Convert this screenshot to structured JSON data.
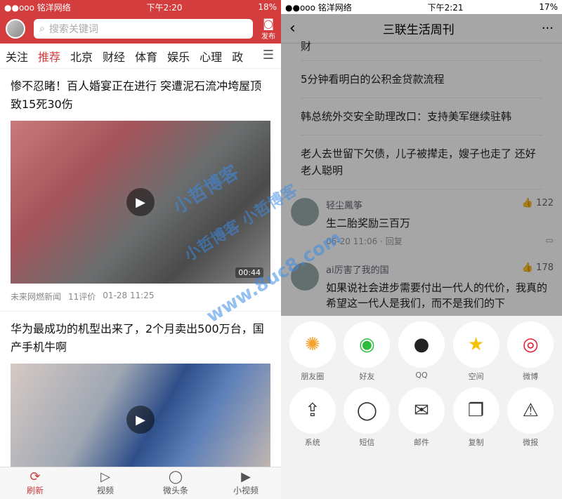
{
  "left": {
    "status": {
      "carrier": "●●ooo 铭洋网络",
      "time": "下午2:20",
      "battery": "18%"
    },
    "search_placeholder": "搜索关键词",
    "publish_label": "发布",
    "categories": [
      "关注",
      "推荐",
      "北京",
      "财经",
      "体育",
      "娱乐",
      "心理",
      "政"
    ],
    "news": [
      {
        "title": "惨不忍睹！百人婚宴正在进行 突遭泥石流冲垮屋顶致15死30伤",
        "duration": "00:44",
        "source": "未来网燃新闻",
        "comments": "11评价",
        "time": "01-28 11:25"
      },
      {
        "title": "华为最成功的机型出来了，2个月卖出500万台，国产手机牛啊"
      }
    ],
    "tabs": [
      "刷新",
      "视频",
      "微头条",
      "小视频"
    ]
  },
  "right": {
    "status": {
      "carrier": "●●ooo 铭洋网络",
      "time": "下午2:21",
      "battery": "17%"
    },
    "title": "三联生活周刊",
    "partial_top": "财",
    "items": [
      "5分钟看明白的公积金贷款流程",
      "韩总统外交安全助理改口：支持美军继续驻韩",
      "老人去世留下欠债，儿子被撵走，嫂子也走了 还好老人聪明"
    ],
    "comments": [
      {
        "user": "轻尘鳳筝",
        "likes": "122",
        "text": "生二胎奖励三百万",
        "time": "06-20 11:06 · 回复"
      },
      {
        "user": "ai厉害了我的国",
        "likes": "178",
        "text": "如果说社会进步需要付出一代人的代价，我真的希望这一代人是我们，而不是我们的下"
      }
    ],
    "share_row1": [
      "朋友圈",
      "好友",
      "QQ",
      "空间",
      "微博"
    ],
    "share_row2": [
      "系统",
      "短信",
      "邮件",
      "复制",
      "微报"
    ]
  },
  "watermark": [
    "小哲博客",
    "www.8uc8.com",
    "小哲博客 小哲博客"
  ]
}
